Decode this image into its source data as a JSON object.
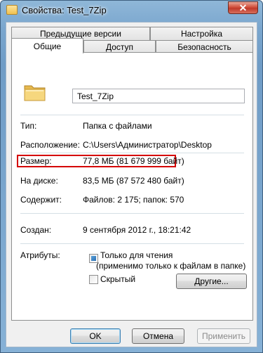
{
  "window": {
    "title": "Свойства: Test_7Zip",
    "close_glyph": "✕"
  },
  "tabs_back": [
    {
      "label": "Предыдущие версии"
    },
    {
      "label": "Настройка"
    }
  ],
  "tabs_front": [
    {
      "label": "Общие",
      "active": true
    },
    {
      "label": "Доступ"
    },
    {
      "label": "Безопасность"
    }
  ],
  "general": {
    "folder_name": "Test_7Zip",
    "type_label": "Тип:",
    "type_value": "Папка с файлами",
    "location_label": "Расположение:",
    "location_value": "C:\\Users\\Администратор\\Desktop",
    "size_label": "Размер:",
    "size_value": "77,8 МБ (81 679 999 байт)",
    "disk_label": "На диске:",
    "disk_value": "83,5 МБ (87 572 480 байт)",
    "contains_label": "Содержит:",
    "contains_value": "Файлов: 2 175; папок: 570",
    "created_label": "Создан:",
    "created_value": "9 сентября 2012 г., 18:21:42",
    "attributes_label": "Атрибуты:",
    "readonly_label": "Только для чтения",
    "readonly_note": "(применимо только к файлам в папке)",
    "hidden_label": "Скрытый",
    "other_button": "Другие..."
  },
  "footer": {
    "ok_label": "OK",
    "cancel_label": "Отмена",
    "apply_label": "Применить"
  },
  "colors": {
    "highlight": "#d40000",
    "titlebar": "#7aa6ce",
    "dialog": "#f0f0f0"
  }
}
